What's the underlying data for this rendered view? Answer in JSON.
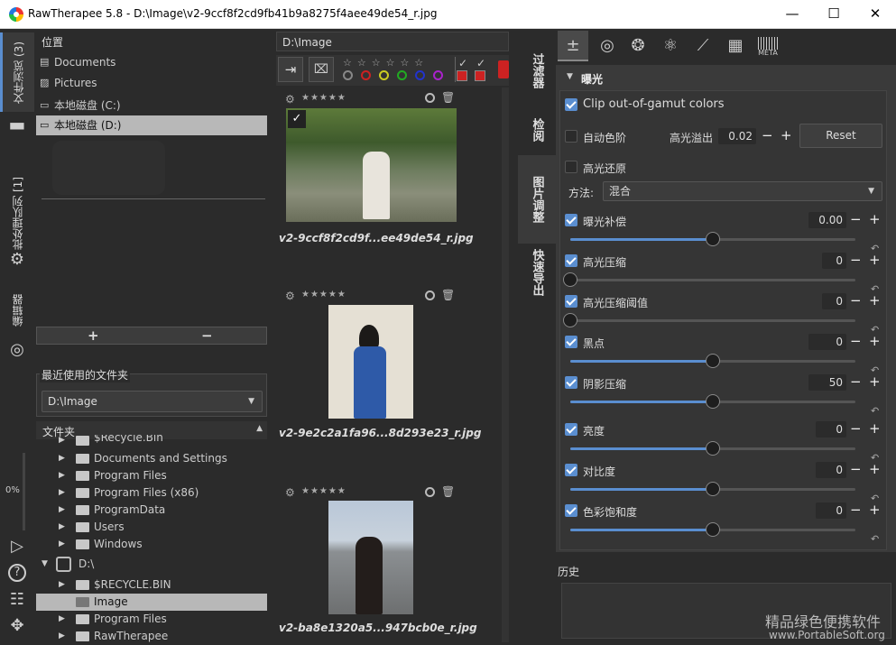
{
  "title": "RawTherapee 5.8 - D:\\Image\\v2-9ccf8f2cd9fb41b9a8275f4aee49de54_r.jpg",
  "window_buttons": {
    "minimize": "—",
    "maximize": "☐",
    "close": "✕"
  },
  "left_tabs": {
    "file_browser": "文件浏览 (3)",
    "batch_queue": "批处理队列 [1]",
    "editor": "编辑器"
  },
  "progress": "0%",
  "places": {
    "header": "位置",
    "items": [
      "Documents",
      "Pictures",
      "本地磁盘 (C:)",
      "本地磁盘 (D:)"
    ],
    "add": "+",
    "remove": "−"
  },
  "recent": {
    "label": "最近使用的文件夹",
    "value": "D:\\Image"
  },
  "folders": {
    "header": "文件夹",
    "rows": [
      "$Recycle.Bin",
      "Documents and Settings",
      "Program Files",
      "Program Files (x86)",
      "ProgramData",
      "Users",
      "Windows",
      "D:\\",
      "$RECYCLE.BIN",
      "Image",
      "Program Files",
      "RawTherapee"
    ]
  },
  "path_bar": "D:\\Image",
  "thumbnails": [
    {
      "name": "v2-9ccf8f2cd9f...ee49de54_r.jpg"
    },
    {
      "name": "v2-9e2c2a1fa96...8d293e23_r.jpg"
    },
    {
      "name": "v2-ba8e1320a5...947bcb0e_r.jpg"
    }
  ],
  "stars": "★★★★★",
  "right_tabs": {
    "filter": "过滤器",
    "inspect": "检阅",
    "image_adjust": "图片调整",
    "quick_export": "快速导出"
  },
  "tool_tabs": {
    "meta": "META"
  },
  "exposure": {
    "header": "曝光",
    "clip_label": "Clip out-of-gamut colors",
    "auto_levels": "自动色阶",
    "highlight_overflow": "高光溢出",
    "highlight_overflow_value": "0.02",
    "reset": "Reset",
    "highlight_recovery": "高光还原",
    "method_label": "方法:",
    "method_value": "混合",
    "sliders": [
      {
        "label": "曝光补偿",
        "value": "0.00",
        "level": 0.5
      },
      {
        "label": "高光压缩",
        "value": "0",
        "level": 0
      },
      {
        "label": "高光压缩阈值",
        "value": "0",
        "level": 0
      },
      {
        "label": "黑点",
        "value": "0",
        "level": 0.5
      },
      {
        "label": "阴影压缩",
        "value": "50",
        "level": 0.5
      },
      {
        "label": "亮度",
        "value": "0",
        "level": 0.5
      },
      {
        "label": "对比度",
        "value": "0",
        "level": 0.5
      },
      {
        "label": "色彩饱和度",
        "value": "0",
        "level": 0.5
      }
    ]
  },
  "history": {
    "label": "历史"
  },
  "watermark": {
    "line1": "精品绿色便携软件",
    "line2": "www.PortableSoft.org"
  }
}
